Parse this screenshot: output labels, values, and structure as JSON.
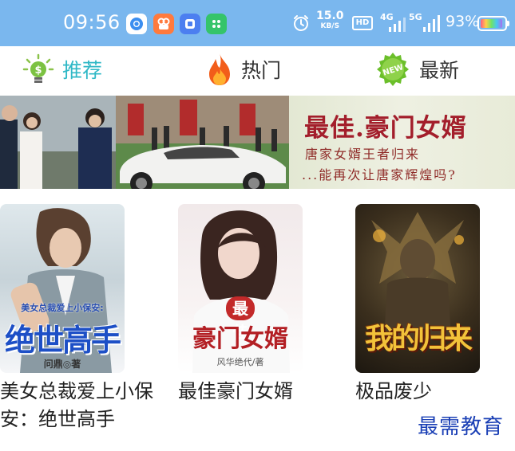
{
  "status_bar": {
    "time": "09:56",
    "net_speed_value": "15.0",
    "net_speed_unit": "KB/S",
    "hd_label": "HD",
    "signal_4g": "4G",
    "signal_5g": "5G",
    "battery_percent": "93%",
    "battery_level": 0.93,
    "app_icons": [
      "chrome-icon",
      "camera-app-icon",
      "files-app-icon",
      "wechat-mini-icon"
    ]
  },
  "tabs": [
    {
      "label": "推荐",
      "icon": "lightbulb-money-icon",
      "active": true
    },
    {
      "label": "热门",
      "icon": "fire-icon",
      "active": false
    },
    {
      "label": "最新",
      "icon": "new-badge-icon",
      "active": false
    }
  ],
  "banner": {
    "title": "最佳.豪门女婿",
    "line1": "唐家女婿王者归来",
    "line2": "...能再次让唐家辉煌吗?"
  },
  "books": [
    {
      "title": "美女总裁爱上小保安：绝世高手",
      "cover_top": "美女总裁爱上小保安:",
      "cover_main": "绝世高手",
      "cover_author": "问鼎◎著"
    },
    {
      "title": "最佳豪门女婿",
      "cover_badge": "最佳",
      "cover_main": "豪门女婿",
      "cover_author": "风华绝代/著"
    },
    {
      "title": "极品废少",
      "cover_main": "我的归来"
    }
  ],
  "watermark": "最需教育",
  "colors": {
    "status_bar_bg": "#7ab7ee",
    "active_tab": "#2fb8c6",
    "banner_title": "#a31e2b",
    "watermark": "#1a3fb5"
  }
}
